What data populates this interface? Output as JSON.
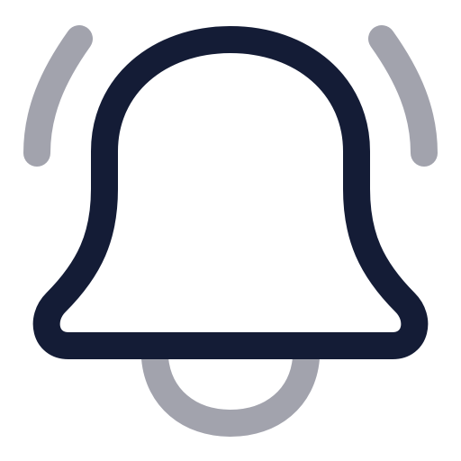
{
  "icon": {
    "name": "bell-ringing-icon",
    "colors": {
      "primary": "#141C36",
      "secondary": "#A2A3AD",
      "background": "#FFFFFF"
    }
  }
}
